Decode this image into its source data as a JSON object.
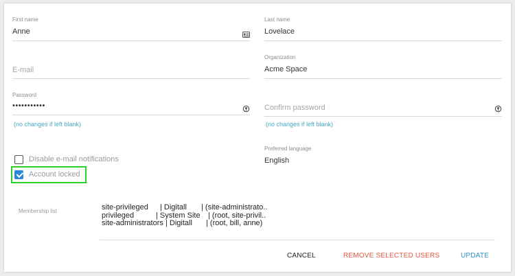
{
  "form": {
    "first_name": {
      "label": "First name",
      "value": "Anne"
    },
    "last_name": {
      "label": "Last name",
      "value": "Lovelace"
    },
    "email": {
      "placeholder": "E-mail"
    },
    "organization": {
      "label": "Organization",
      "value": "Acme Space"
    },
    "password": {
      "label": "Password",
      "value": "•••••••••••",
      "hint": "(no changes if left blank)"
    },
    "confirm_password": {
      "placeholder": "Confirm password",
      "hint": "(no changes if left blank)"
    },
    "disable_email": {
      "label": "Disable e-mail notifications",
      "checked": false
    },
    "account_locked": {
      "label": "Account locked",
      "checked": true
    },
    "language": {
      "label": "Preferred language",
      "value": "English"
    }
  },
  "membership": {
    "label": "Membership list",
    "rows": [
      {
        "group": "site-privileged",
        "site": "| Digitall",
        "members": "| (site-administrato.."
      },
      {
        "group": "privileged",
        "site": "| System Site",
        "members": "| (root, site-privil.."
      },
      {
        "group": "site-administrators",
        "site": "| Digitall",
        "members": "| (root, bill, anne)"
      }
    ]
  },
  "actions": {
    "cancel": "CANCEL",
    "remove": "REMOVE SELECTED USERS",
    "update": "UPDATE"
  },
  "colors": {
    "accent": "#2b88d8",
    "hint": "#4aa7c8",
    "remove": "#e0593f",
    "update": "#2f8fd0",
    "highlight": "#2bd12b"
  }
}
